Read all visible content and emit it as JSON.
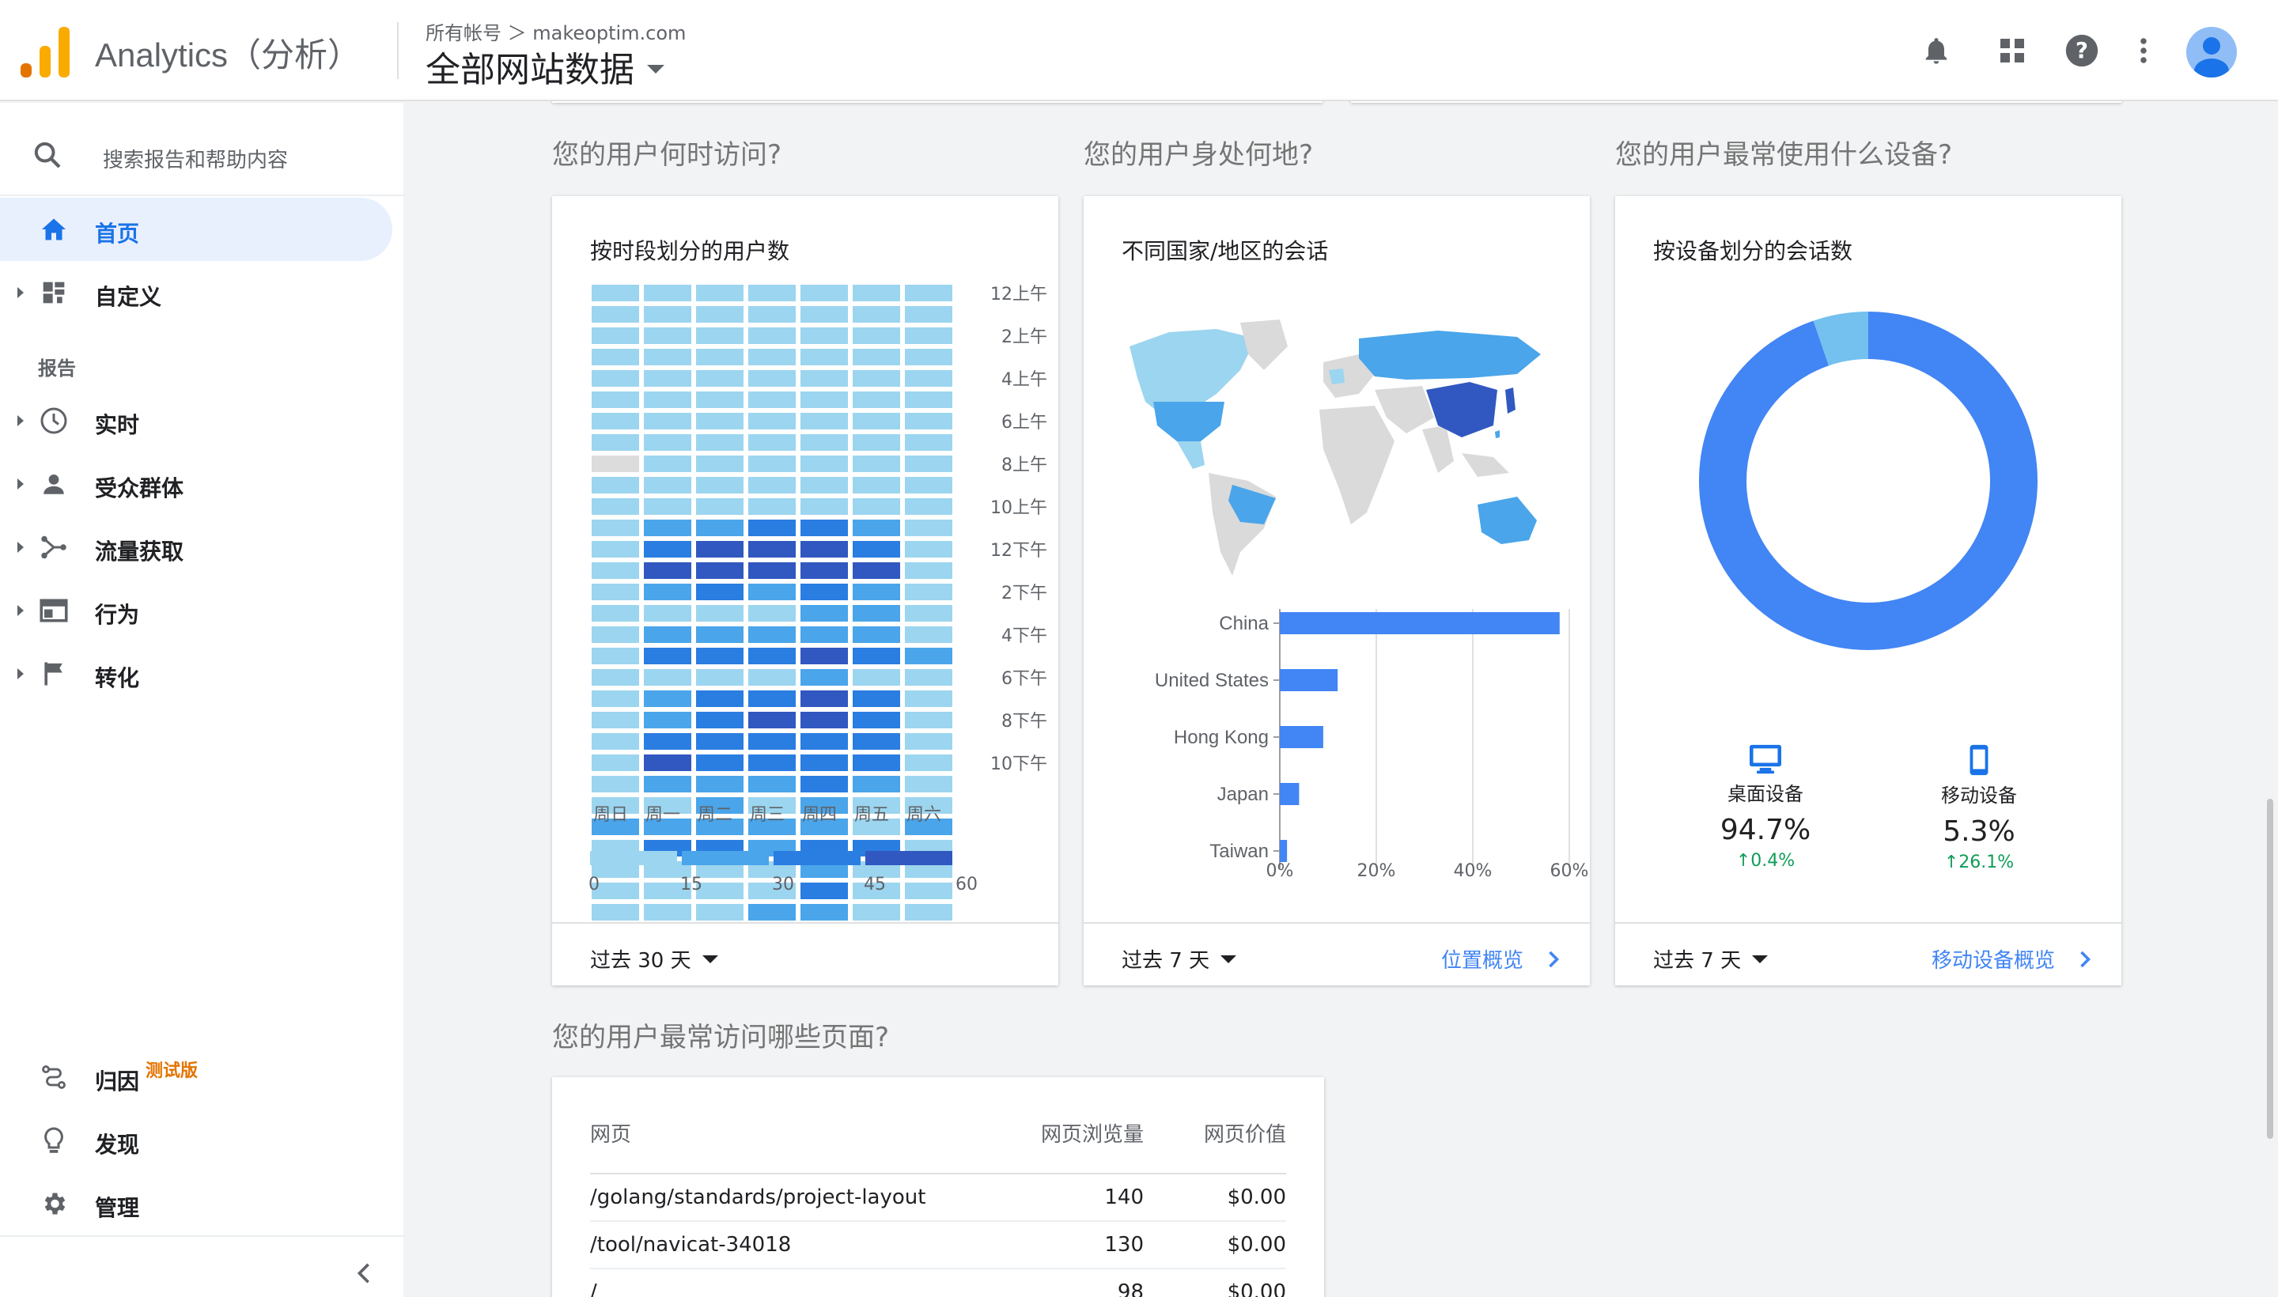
{
  "topbar": {
    "app_title": "Analytics（分析）",
    "breadcrumb": "所有帐号 ＞ makeoptim.com",
    "view": "全部网站数据"
  },
  "sidebar": {
    "search_placeholder": "搜索报告和帮助内容",
    "reports_heading": "报告",
    "items": [
      {
        "label": "首页",
        "icon": "home-icon"
      },
      {
        "label": "自定义",
        "icon": "dashboard-icon"
      },
      {
        "label": "实时",
        "icon": "clock-icon"
      },
      {
        "label": "受众群体",
        "icon": "person-icon"
      },
      {
        "label": "流量获取",
        "icon": "acquisition-icon"
      },
      {
        "label": "行为",
        "icon": "behavior-icon"
      },
      {
        "label": "转化",
        "icon": "flag-icon"
      }
    ],
    "bottom_items": [
      {
        "label": "归因",
        "badge": "测试版",
        "icon": "attribution-icon"
      },
      {
        "label": "发现",
        "icon": "lightbulb-icon"
      },
      {
        "label": "管理",
        "icon": "gear-icon"
      }
    ]
  },
  "sections": {
    "when": "您的用户何时访问?",
    "where": "您的用户身处何地?",
    "device": "您的用户最常使用什么设备?",
    "pages": "您的用户最常访问哪些页面?"
  },
  "cards": {
    "heatmap": {
      "title": "按时段划分的用户数",
      "period": "过去 30 天"
    },
    "geo": {
      "title": "不同国家/地区的会话",
      "period": "过去 7 天",
      "link": "位置概览"
    },
    "device": {
      "title": "按设备划分的会话数",
      "period": "过去 7 天",
      "link": "移动设备概览"
    }
  },
  "chart_data": [
    {
      "type": "heatmap",
      "title": "按时段划分的用户数",
      "x_labels": [
        "周日",
        "周一",
        "周二",
        "周三",
        "周四",
        "周五",
        "周六"
      ],
      "y_tick_labels": [
        "12上午",
        "2上午",
        "4上午",
        "6上午",
        "8上午",
        "10上午",
        "12下午",
        "2下午",
        "4下午",
        "6下午",
        "8下午",
        "10下午"
      ],
      "scale_ticks": [
        0,
        15,
        30,
        45,
        60
      ],
      "scale_colors": [
        "#9cd5ef",
        "#4aa5ea",
        "#2a7de1",
        "#3158c0"
      ],
      "levels": [
        [
          0,
          0,
          0,
          0,
          0,
          0,
          0
        ],
        [
          0,
          0,
          0,
          0,
          0,
          0,
          0
        ],
        [
          0,
          0,
          0,
          0,
          0,
          0,
          0
        ],
        [
          0,
          0,
          0,
          0,
          0,
          0,
          0
        ],
        [
          0,
          0,
          0,
          0,
          0,
          0,
          0
        ],
        [
          0,
          0,
          0,
          0,
          0,
          0,
          0
        ],
        [
          0,
          0,
          0,
          0,
          0,
          0,
          0
        ],
        [
          0,
          0,
          0,
          0,
          0,
          0,
          0
        ],
        [
          -1,
          0,
          0,
          0,
          0,
          0,
          0
        ],
        [
          0,
          0,
          0,
          0,
          0,
          0,
          0
        ],
        [
          0,
          0,
          0,
          0,
          0,
          0,
          0
        ],
        [
          0,
          1,
          1,
          2,
          2,
          1,
          0
        ],
        [
          0,
          2,
          3,
          3,
          3,
          2,
          0
        ],
        [
          0,
          3,
          3,
          3,
          3,
          3,
          0
        ],
        [
          0,
          1,
          2,
          1,
          2,
          1,
          0
        ],
        [
          0,
          0,
          0,
          0,
          1,
          1,
          0
        ],
        [
          0,
          1,
          1,
          1,
          1,
          1,
          0
        ],
        [
          0,
          2,
          2,
          2,
          3,
          2,
          1
        ],
        [
          0,
          0,
          0,
          0,
          1,
          0,
          0
        ],
        [
          0,
          1,
          2,
          2,
          3,
          2,
          0
        ],
        [
          0,
          1,
          2,
          3,
          3,
          2,
          0
        ],
        [
          0,
          2,
          2,
          2,
          2,
          2,
          0
        ],
        [
          0,
          3,
          2,
          2,
          2,
          2,
          0
        ],
        [
          0,
          1,
          1,
          1,
          2,
          1,
          0
        ],
        [
          0,
          0,
          1,
          0,
          1,
          0,
          0
        ],
        [
          1,
          1,
          1,
          1,
          1,
          0,
          1
        ],
        [
          0,
          2,
          2,
          1,
          2,
          2,
          0
        ],
        [
          0,
          0,
          0,
          0,
          1,
          0,
          0
        ],
        [
          0,
          0,
          0,
          0,
          2,
          0,
          0
        ],
        [
          0,
          0,
          0,
          1,
          1,
          0,
          0
        ]
      ]
    },
    {
      "type": "bar",
      "title": "不同国家/地区的会话",
      "orientation": "horizontal",
      "categories": [
        "China",
        "United States",
        "Hong Kong",
        "Japan",
        "Taiwan"
      ],
      "values": [
        58,
        12,
        9,
        4,
        1.5
      ],
      "x_ticks": [
        "0%",
        "20%",
        "40%",
        "60%"
      ],
      "xlim": [
        0,
        60
      ],
      "color": "#4285f4"
    },
    {
      "type": "pie",
      "title": "按设备划分的会话数",
      "series": [
        {
          "name": "桌面设备",
          "value": 94.7,
          "change": "0.4%",
          "color": "#4285f4",
          "icon": "desktop-icon"
        },
        {
          "name": "移动设备",
          "value": 5.3,
          "change": "26.1%",
          "color": "#74c0ef",
          "icon": "mobile-icon"
        }
      ],
      "values_text": [
        "94.7%",
        "5.3%"
      ]
    }
  ],
  "pages_table": {
    "headers": [
      "网页",
      "网页浏览量",
      "网页价值"
    ],
    "rows": [
      [
        "/golang/standards/project-layout",
        "140",
        "$0.00"
      ],
      [
        "/tool/navicat-34018",
        "130",
        "$0.00"
      ],
      [
        "/",
        "98",
        "$0.00"
      ]
    ]
  },
  "colors": {
    "accent": "#1a73e8",
    "bar": "#4285f4",
    "logo": "#f9ab00"
  }
}
